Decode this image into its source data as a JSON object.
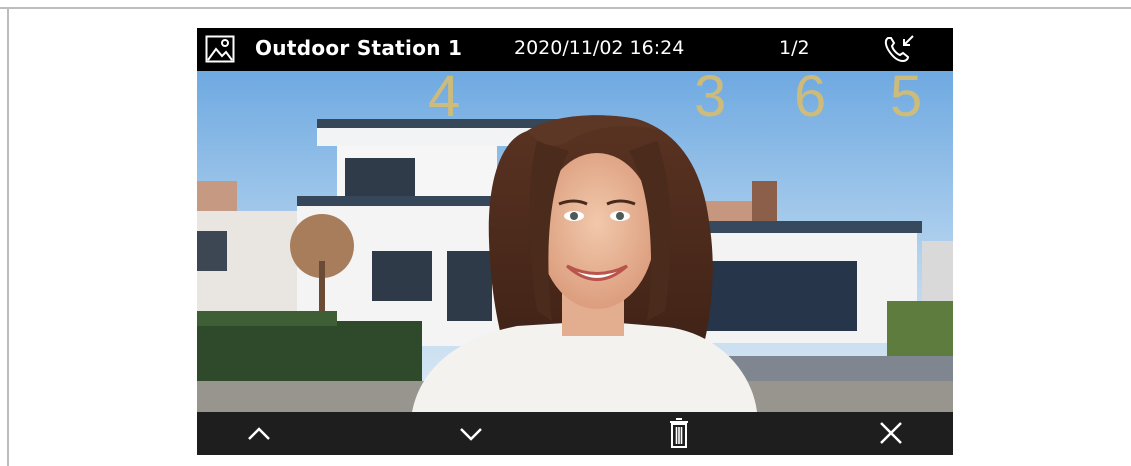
{
  "topbar": {
    "gallery_icon": "gallery-icon",
    "station_name": "Outdoor Station 1",
    "datetime": "2020/11/02 16:24",
    "page_counter": "1/2",
    "call_icon": "incoming-call-icon"
  },
  "overlay_digits": [
    "4",
    "3",
    "6",
    "5"
  ],
  "bottombar": {
    "up_icon": "chevron-up-icon",
    "down_icon": "chevron-down-icon",
    "delete_icon": "trash-icon",
    "close_icon": "close-icon"
  },
  "colors": {
    "bar_background": "#000000",
    "bottom_bar_background": "#1e1e1e",
    "digit_color": "#d4bd73",
    "frame_line": "#bdbdbd"
  }
}
